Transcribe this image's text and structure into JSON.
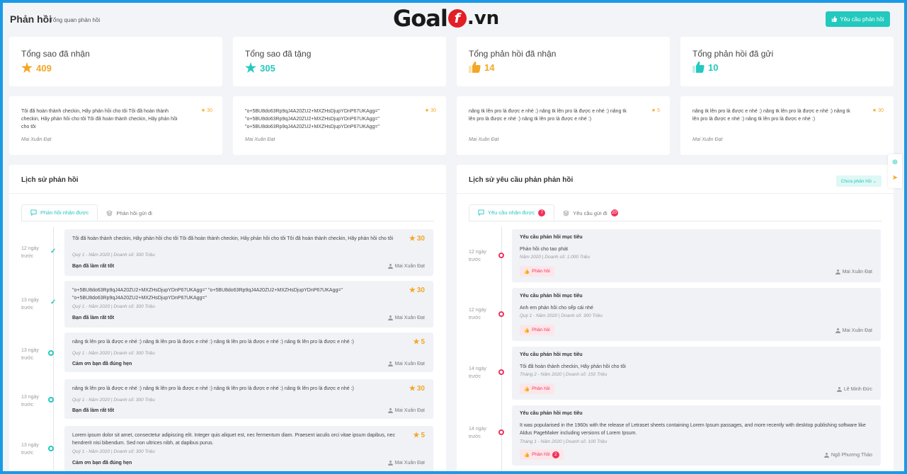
{
  "header": {
    "title": "Phản hồi",
    "subtitle": "Tổng quan phản hồi",
    "logo": {
      "part1": "Goal",
      "part2": "f",
      "part3": ".vn"
    },
    "request_button": "Yêu cầu phản hồi"
  },
  "stats": [
    {
      "label": "Tổng sao đã nhận",
      "value": "409",
      "icon": "star-icon",
      "color": "#f5a623"
    },
    {
      "label": "Tổng sao đã tặng",
      "value": "305",
      "icon": "star-icon",
      "color": "#23c9be"
    },
    {
      "label": "Tổng phản hồi đã nhận",
      "value": "14",
      "icon": "thumbs-up-icon",
      "color": "#f5a623"
    },
    {
      "label": "Tổng phản hồi đã gửi",
      "value": "10",
      "icon": "thumbs-up-icon",
      "color": "#23c9be"
    }
  ],
  "feedback_cards": [
    {
      "text": "Tôi đã hoàn thành checkin, Hãy phản hồi cho tôi Tôi đã hoàn thành checkin, Hãy phản hồi cho tôi Tôi đã hoàn thành checkin, Hãy phản hồi cho tôi",
      "stars": "30",
      "author": "Mai Xuân Đạt"
    },
    {
      "text": "\"o+5BU8do63Rp9qJ4A20ZU2+MXZHsDjupYDnP67UKAgg=\" \"o+5BU8do63Rp9qJ4A20ZU2+MXZHsDjupYDnP67UKAgg=\" \"o+5BU8do63Rp9qJ4A20ZU2+MXZHsDjupYDnP67UKAgg=\"",
      "stars": "30",
      "author": "Mai Xuân Đạt"
    },
    {
      "text": "nâng tk lên pro là được e nhé :) nâng tk lên pro là được e nhé :) nâng tk lên pro là được e nhé :) nâng tk lên pro là được e nhé :)",
      "stars": "5",
      "author": "Mai Xuân Đạt"
    },
    {
      "text": "nâng tk lên pro là được e nhé :) nâng tk lên pro là được e nhé :) nâng tk lên pro là được e nhé :) nâng tk lên pro là được e nhé :)",
      "stars": "30",
      "author": "Mai Xuân Đạt"
    }
  ],
  "history": {
    "title": "Lịch sử phản hồi",
    "tabs": [
      "Phản hồi nhận được",
      "Phản hồi gửi đi"
    ],
    "items": [
      {
        "date1": "12 ngày",
        "date2": "trước",
        "text": "Tôi đã hoàn thành checkin, Hãy phản hồi cho tôi Tôi đã hoàn thành checkin, Hãy phản hồi cho tôi Tôi đã hoàn thành checkin, Hãy phản hồi cho tôi",
        "meta": "Quý 1 - Năm 2020 | Doanh số: 300 Triệu",
        "comment": "Bạn đã làm rất tốt",
        "author": "Mai Xuân Đạt",
        "stars": "30",
        "status": "done"
      },
      {
        "date1": "13 ngày",
        "date2": "trước",
        "text": "\"o+5BU8do63Rp9qJ4A20ZU2+MXZHsDjupYDnP67UKAgg=\" \"o+5BU8do63Rp9qJ4A20ZU2+MXZHsDjupYDnP67UKAgg=\" \"o+5BU8do63Rp9qJ4A20ZU2+MXZHsDjupYDnP67UKAgg=\"",
        "meta": "Quý 1 - Năm 2020 | Doanh số: 300 Triệu",
        "comment": "Bạn đã làm rất tốt",
        "author": "Mai Xuân Đạt",
        "stars": "30",
        "status": "done"
      },
      {
        "date1": "13 ngày",
        "date2": "trước",
        "text": "nâng tk lên pro là được e nhé :) nâng tk lên pro là được e nhé :) nâng tk lên pro là được e nhé :) nâng tk lên pro là được e nhé :)",
        "meta": "Quý 1 - Năm 2020 | Doanh số: 300 Triệu",
        "comment": "Cảm ơn bạn đã đúng hẹn",
        "author": "Mai Xuân Đạt",
        "stars": "5",
        "status": "pending"
      },
      {
        "date1": "13 ngày",
        "date2": "trước",
        "text": "nâng tk lên pro là được e nhé :) nâng tk lên pro là được e nhé :) nâng tk lên pro là được e nhé :) nâng tk lên pro là được e nhé :)",
        "meta": "Quý 1 - Năm 2020 | Doanh số: 300 Triệu",
        "comment": "Bạn đã làm rất tốt",
        "author": "Mai Xuân Đạt",
        "stars": "30",
        "status": "pending"
      },
      {
        "date1": "13 ngày",
        "date2": "trước",
        "text": "Lorem ipsum dolor sit amet, consectetur adipiscing elit. Integer quis aliquet est, nec fermentum diam. Praesent iaculis orci vitae ipsum dapibus, nec hendrerit nisi bibendum. Sed non ultrices nibh, at dapibus purus.",
        "meta": "Quý 1 - Năm 2020 | Doanh số: 300 Triệu",
        "comment": "Cảm ơn bạn đã đúng hẹn",
        "author": "Mai Xuân Đạt",
        "stars": "5",
        "status": "pending"
      }
    ]
  },
  "requests": {
    "title": "Lịch sử yêu cầu phản phản hồi",
    "filter": "Chưa phản hồi ⌄",
    "tabs": [
      {
        "label": "Yêu cầu nhận được",
        "badge": "7"
      },
      {
        "label": "Yêu cầu gửi đi",
        "badge": "20"
      }
    ],
    "items": [
      {
        "date1": "12 ngày",
        "date2": "trước",
        "title": "Yêu cầu phản hồi mục tiêu",
        "desc": "Phản hồi cho tao phát",
        "meta": "Năm 2020 | Doanh số: 1.000 Triệu",
        "button": "Phản hồi",
        "author": "Mai Xuân Đạt",
        "badge": ""
      },
      {
        "date1": "12 ngày",
        "date2": "trước",
        "title": "Yêu cầu phản hồi mục tiêu",
        "desc": "Anh em phản hồi cho sếp cái nhé",
        "meta": "Quý 1 - Năm 2020 | Doanh số: 300 Triệu",
        "button": "Phản hồi",
        "author": "Mai Xuân Đạt",
        "badge": ""
      },
      {
        "date1": "14 ngày",
        "date2": "trước",
        "title": "Yêu cầu phản hồi mục tiêu",
        "desc": "Tôi đã hoàn thành checkin, Hãy phản hồi cho tôi",
        "meta": "Tháng 2 - Năm 2020 | Doanh số: 150 Triệu",
        "button": "Phản hồi",
        "author": "Lê Minh Đức",
        "badge": ""
      },
      {
        "date1": "14 ngày",
        "date2": "trước",
        "title": "Yêu cầu phản hồi mục tiêu",
        "desc": "It was popularised in the 1960s with the release of Letraset sheets containing Lorem Ipsum passages, and more recently with desktop publishing software like Aldus PageMaker including versions of Lorem Ipsum.",
        "meta": "Tháng 1 - Năm 2020 | Doanh số: 100 Triệu",
        "button": "Phản hồi",
        "author": "Ngô Phương Thảo",
        "badge": "2"
      }
    ]
  }
}
